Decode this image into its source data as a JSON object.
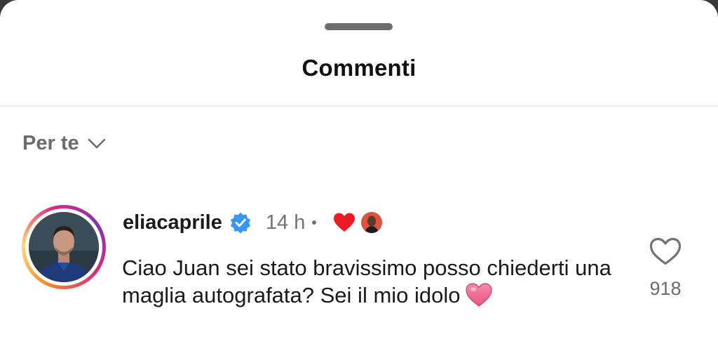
{
  "sheet": {
    "title": "Commenti"
  },
  "sort": {
    "label": "Per te",
    "icon": "chevron-down-icon"
  },
  "comment": {
    "username": "eliacaprile",
    "verified": true,
    "time": "14 h",
    "liked_by_creator": true,
    "text": "Ciao Juan sei stato bravissimo posso chiederti una maglia autografata? Sei il mio idolo",
    "emoji": "pink-heart",
    "likes": "918"
  },
  "colors": {
    "verified_blue": "#3897f0",
    "heart_red": "#ed1c24",
    "emoji_pink": "#f06b9a",
    "muted_text": "#737373"
  }
}
